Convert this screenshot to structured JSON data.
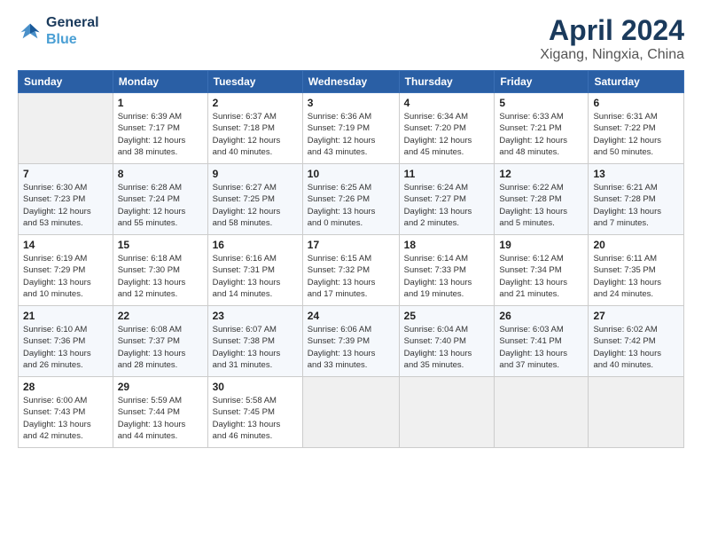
{
  "logo": {
    "line1": "General",
    "line2": "Blue"
  },
  "title": "April 2024",
  "subtitle": "Xigang, Ningxia, China",
  "headers": [
    "Sunday",
    "Monday",
    "Tuesday",
    "Wednesday",
    "Thursday",
    "Friday",
    "Saturday"
  ],
  "weeks": [
    {
      "days": [
        {
          "num": "",
          "info": ""
        },
        {
          "num": "1",
          "info": "Sunrise: 6:39 AM\nSunset: 7:17 PM\nDaylight: 12 hours\nand 38 minutes."
        },
        {
          "num": "2",
          "info": "Sunrise: 6:37 AM\nSunset: 7:18 PM\nDaylight: 12 hours\nand 40 minutes."
        },
        {
          "num": "3",
          "info": "Sunrise: 6:36 AM\nSunset: 7:19 PM\nDaylight: 12 hours\nand 43 minutes."
        },
        {
          "num": "4",
          "info": "Sunrise: 6:34 AM\nSunset: 7:20 PM\nDaylight: 12 hours\nand 45 minutes."
        },
        {
          "num": "5",
          "info": "Sunrise: 6:33 AM\nSunset: 7:21 PM\nDaylight: 12 hours\nand 48 minutes."
        },
        {
          "num": "6",
          "info": "Sunrise: 6:31 AM\nSunset: 7:22 PM\nDaylight: 12 hours\nand 50 minutes."
        }
      ]
    },
    {
      "days": [
        {
          "num": "7",
          "info": "Sunrise: 6:30 AM\nSunset: 7:23 PM\nDaylight: 12 hours\nand 53 minutes."
        },
        {
          "num": "8",
          "info": "Sunrise: 6:28 AM\nSunset: 7:24 PM\nDaylight: 12 hours\nand 55 minutes."
        },
        {
          "num": "9",
          "info": "Sunrise: 6:27 AM\nSunset: 7:25 PM\nDaylight: 12 hours\nand 58 minutes."
        },
        {
          "num": "10",
          "info": "Sunrise: 6:25 AM\nSunset: 7:26 PM\nDaylight: 13 hours\nand 0 minutes."
        },
        {
          "num": "11",
          "info": "Sunrise: 6:24 AM\nSunset: 7:27 PM\nDaylight: 13 hours\nand 2 minutes."
        },
        {
          "num": "12",
          "info": "Sunrise: 6:22 AM\nSunset: 7:28 PM\nDaylight: 13 hours\nand 5 minutes."
        },
        {
          "num": "13",
          "info": "Sunrise: 6:21 AM\nSunset: 7:28 PM\nDaylight: 13 hours\nand 7 minutes."
        }
      ]
    },
    {
      "days": [
        {
          "num": "14",
          "info": "Sunrise: 6:19 AM\nSunset: 7:29 PM\nDaylight: 13 hours\nand 10 minutes."
        },
        {
          "num": "15",
          "info": "Sunrise: 6:18 AM\nSunset: 7:30 PM\nDaylight: 13 hours\nand 12 minutes."
        },
        {
          "num": "16",
          "info": "Sunrise: 6:16 AM\nSunset: 7:31 PM\nDaylight: 13 hours\nand 14 minutes."
        },
        {
          "num": "17",
          "info": "Sunrise: 6:15 AM\nSunset: 7:32 PM\nDaylight: 13 hours\nand 17 minutes."
        },
        {
          "num": "18",
          "info": "Sunrise: 6:14 AM\nSunset: 7:33 PM\nDaylight: 13 hours\nand 19 minutes."
        },
        {
          "num": "19",
          "info": "Sunrise: 6:12 AM\nSunset: 7:34 PM\nDaylight: 13 hours\nand 21 minutes."
        },
        {
          "num": "20",
          "info": "Sunrise: 6:11 AM\nSunset: 7:35 PM\nDaylight: 13 hours\nand 24 minutes."
        }
      ]
    },
    {
      "days": [
        {
          "num": "21",
          "info": "Sunrise: 6:10 AM\nSunset: 7:36 PM\nDaylight: 13 hours\nand 26 minutes."
        },
        {
          "num": "22",
          "info": "Sunrise: 6:08 AM\nSunset: 7:37 PM\nDaylight: 13 hours\nand 28 minutes."
        },
        {
          "num": "23",
          "info": "Sunrise: 6:07 AM\nSunset: 7:38 PM\nDaylight: 13 hours\nand 31 minutes."
        },
        {
          "num": "24",
          "info": "Sunrise: 6:06 AM\nSunset: 7:39 PM\nDaylight: 13 hours\nand 33 minutes."
        },
        {
          "num": "25",
          "info": "Sunrise: 6:04 AM\nSunset: 7:40 PM\nDaylight: 13 hours\nand 35 minutes."
        },
        {
          "num": "26",
          "info": "Sunrise: 6:03 AM\nSunset: 7:41 PM\nDaylight: 13 hours\nand 37 minutes."
        },
        {
          "num": "27",
          "info": "Sunrise: 6:02 AM\nSunset: 7:42 PM\nDaylight: 13 hours\nand 40 minutes."
        }
      ]
    },
    {
      "days": [
        {
          "num": "28",
          "info": "Sunrise: 6:00 AM\nSunset: 7:43 PM\nDaylight: 13 hours\nand 42 minutes."
        },
        {
          "num": "29",
          "info": "Sunrise: 5:59 AM\nSunset: 7:44 PM\nDaylight: 13 hours\nand 44 minutes."
        },
        {
          "num": "30",
          "info": "Sunrise: 5:58 AM\nSunset: 7:45 PM\nDaylight: 13 hours\nand 46 minutes."
        },
        {
          "num": "",
          "info": ""
        },
        {
          "num": "",
          "info": ""
        },
        {
          "num": "",
          "info": ""
        },
        {
          "num": "",
          "info": ""
        }
      ]
    }
  ]
}
